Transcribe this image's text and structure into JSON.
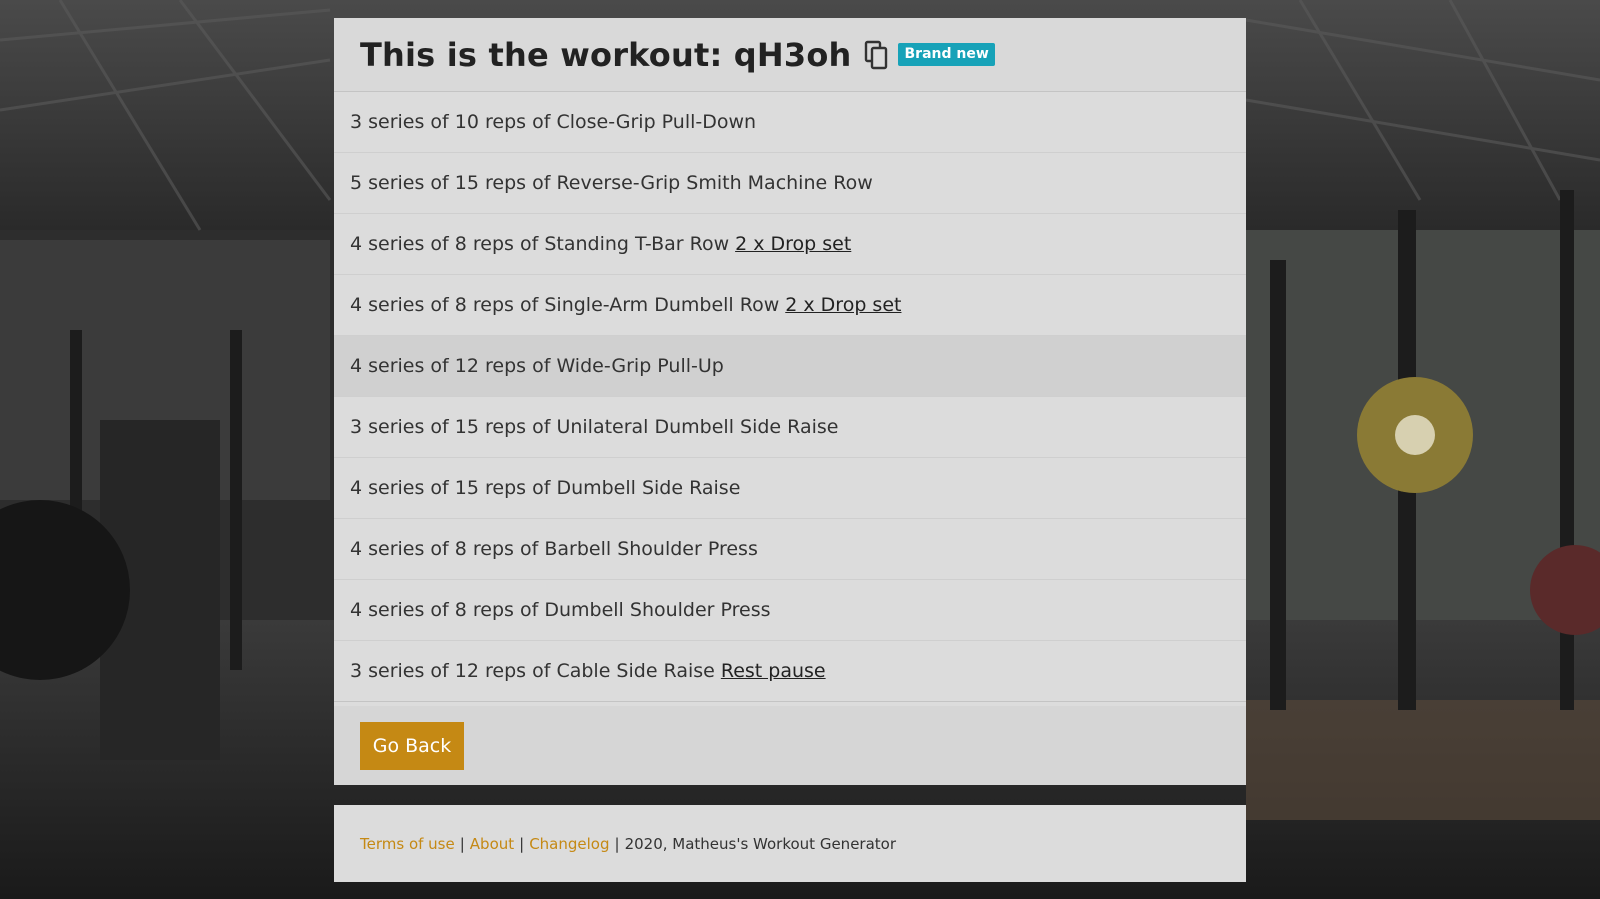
{
  "header": {
    "title": "This is the workout: qH3oh",
    "badge": "Brand new",
    "copy_icon": "copy-icon"
  },
  "exercises": [
    {
      "text": "3 series of 10 reps of Close-Grip Pull-Down",
      "technique": ""
    },
    {
      "text": "5 series of 15 reps of Reverse-Grip Smith Machine Row",
      "technique": ""
    },
    {
      "text": "4 series of 8 reps of Standing T-Bar Row",
      "technique": "2 x Drop set"
    },
    {
      "text": "4 series of 8 reps of Single-Arm Dumbell Row",
      "technique": "2 x Drop set"
    },
    {
      "text": "4 series of 12 reps of Wide-Grip Pull-Up",
      "technique": ""
    },
    {
      "text": "3 series of 15 reps of Unilateral Dumbell Side Raise",
      "technique": ""
    },
    {
      "text": "4 series of 15 reps of Dumbell Side Raise",
      "technique": ""
    },
    {
      "text": "4 series of 8 reps of Barbell Shoulder Press",
      "technique": ""
    },
    {
      "text": "4 series of 8 reps of Dumbell Shoulder Press",
      "technique": ""
    },
    {
      "text": "3 series of 12 reps of Cable Side Raise",
      "technique": "Rest pause"
    }
  ],
  "buttons": {
    "go_back": "Go Back"
  },
  "footer": {
    "terms": "Terms of use",
    "about": "About",
    "changelog": "Changelog",
    "separator": "|",
    "copyright": "2020, Matheus's Workout Generator"
  },
  "colors": {
    "accent": "#c58914",
    "badge": "#17a2b8",
    "card": "#dcdcdc"
  }
}
